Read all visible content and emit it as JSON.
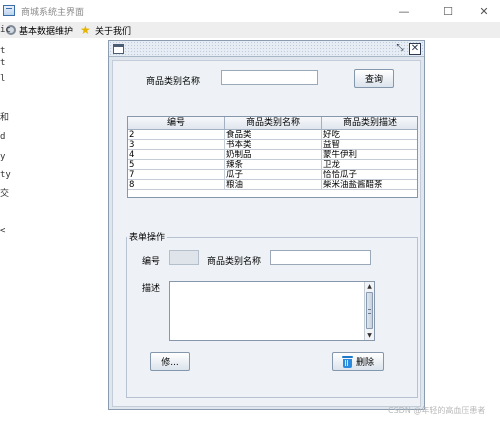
{
  "window": {
    "title": "商城系统主界面",
    "minimize": "—",
    "maximize": "☐",
    "close": "✕"
  },
  "menubar": {
    "items": [
      {
        "label": "基本数据维护",
        "icon": "gear-icon"
      },
      {
        "label": "关于我们",
        "icon": "star-icon"
      }
    ]
  },
  "clipped_left": [
    "ic",
    "t",
    "t",
    "l",
    "和",
    "d",
    "y",
    "ty",
    "交",
    "<"
  ],
  "internal_frame": {
    "restore_icon": "⤡",
    "close_icon": "✕",
    "search": {
      "label": "商品类别名称",
      "value": "",
      "button": "查询"
    },
    "table": {
      "columns": [
        "编号",
        "商品类别名称",
        "商品类别描述"
      ],
      "rows": [
        [
          "2",
          "食品类",
          "好吃"
        ],
        [
          "3",
          "书本类",
          "益智"
        ],
        [
          "4",
          "奶制品",
          "蒙牛伊利"
        ],
        [
          "5",
          "辣条",
          "卫龙"
        ],
        [
          "7",
          "瓜子",
          "恰恰瓜子"
        ],
        [
          "8",
          "粮油",
          "柴米油盐酱醋茶"
        ]
      ]
    },
    "form": {
      "group_title": "表单操作",
      "id_label": "编号",
      "id_value": "",
      "name_label": "商品类别名称",
      "name_value": "",
      "desc_label": "描述",
      "desc_value": "",
      "modify_button": "修...",
      "delete_button": "删除"
    }
  },
  "watermark": "CSDN @年轻的高血压患者"
}
